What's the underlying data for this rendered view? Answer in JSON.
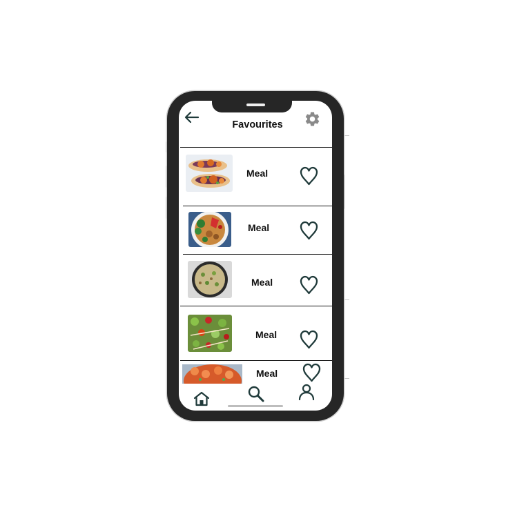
{
  "header": {
    "title": "Favourites"
  },
  "favourites": [
    {
      "label": "Meal",
      "favourited": true
    },
    {
      "label": "Meal",
      "favourited": true
    },
    {
      "label": "Meal",
      "favourited": true
    },
    {
      "label": "Meal",
      "favourited": true
    },
    {
      "label": "Meal",
      "favourited": true
    }
  ],
  "bottom_nav": {
    "items": [
      "home-icon",
      "search-icon",
      "profile-icon"
    ]
  },
  "colors": {
    "icon_dark": "#1f3a3a",
    "gear_gray": "#8a8a8a",
    "phone_body": "#262626"
  }
}
